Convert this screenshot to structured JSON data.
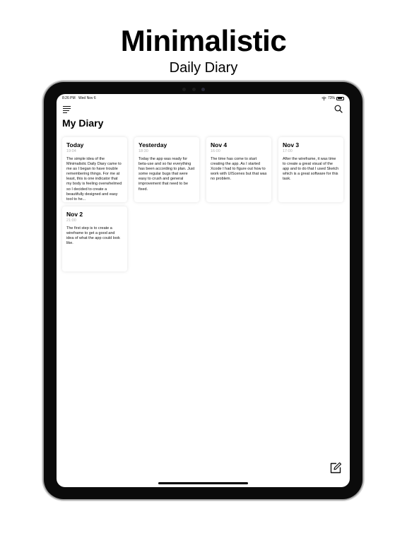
{
  "promo": {
    "title": "Minimalistic",
    "subtitle": "Daily Diary"
  },
  "status_bar": {
    "time": "8:26 PM",
    "date": "Wed Nov 6",
    "battery": "73%"
  },
  "header": {
    "title": "My Diary",
    "menu_icon": "list-icon",
    "search_icon": "search-icon"
  },
  "entries": [
    {
      "title": "Today",
      "time": "19:04",
      "body": "The simple idea of the Minimalistic Daily Diary came to me as I began to have trouble remembering things. For me at least, this is one indicator that my body is feeling overwhelmed so I decided to create a beautifully designed and easy tool to he..."
    },
    {
      "title": "Yesterday",
      "time": "18:30",
      "body": "Today the app was ready for beta-use and so far everything has been according to plan. Just some regular bugs that were easy to crush and general improvement that need to be fixed."
    },
    {
      "title": "Nov 4",
      "time": "16:00",
      "body": "The time has come to start creating the app. As I started Xcode I had to figure out how to work with UIScenes but that was no problem."
    },
    {
      "title": "Nov 3",
      "time": "17:00",
      "body": "After the wireframe, it was time to create a great visual of the app and to do that I used Sketch which is a great software for this task."
    },
    {
      "title": "Nov 2",
      "time": "21:00",
      "body": "The first step is to create a wireframe to get a good and idea of what the app could look like."
    }
  ],
  "toolbar": {
    "compose_icon": "compose-icon"
  },
  "colors": {
    "background": "#ffffff",
    "device_bezel": "#0b0b0b",
    "timestamp_gray": "#b0b0b0",
    "text": "#000000"
  }
}
